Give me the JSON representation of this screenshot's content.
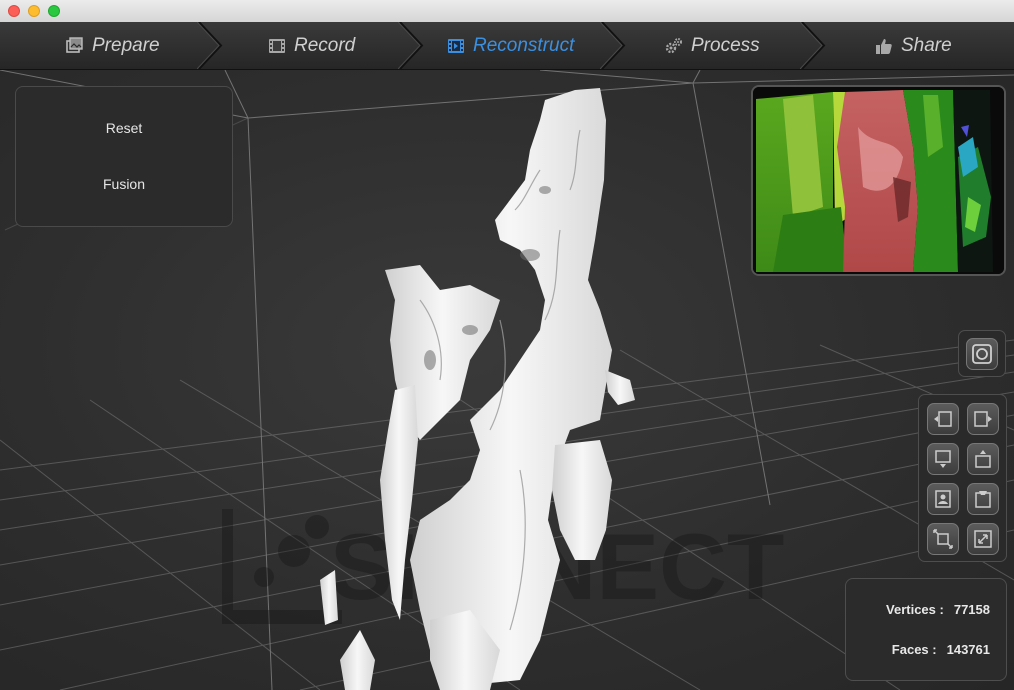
{
  "window": {
    "controls": [
      "close",
      "minimize",
      "maximize"
    ]
  },
  "wizard": {
    "steps": [
      {
        "label": "Prepare",
        "icon": "photos-icon",
        "active": false
      },
      {
        "label": "Record",
        "icon": "film-icon",
        "active": false
      },
      {
        "label": "Reconstruct",
        "icon": "film-icon",
        "active": true
      },
      {
        "label": "Process",
        "icon": "gears-icon",
        "active": false
      },
      {
        "label": "Share",
        "icon": "thumbs-up-icon",
        "active": false
      }
    ],
    "active_color": "#3b8fe0"
  },
  "left_panel": {
    "reset_label": "Reset",
    "fusion_label": "Fusion"
  },
  "watermark": {
    "text": "SKANECT"
  },
  "view_controls": {
    "camera": "camera-icon",
    "buttons": [
      "view-left-icon",
      "view-right-icon",
      "view-bottom-icon",
      "view-top-icon",
      "view-front-icon",
      "view-back-icon",
      "fit-view-icon",
      "fullscreen-icon"
    ]
  },
  "stats": {
    "vertices_label": "Vertices :",
    "vertices_value": "77158",
    "faces_label": "Faces :",
    "faces_value": "143761"
  }
}
